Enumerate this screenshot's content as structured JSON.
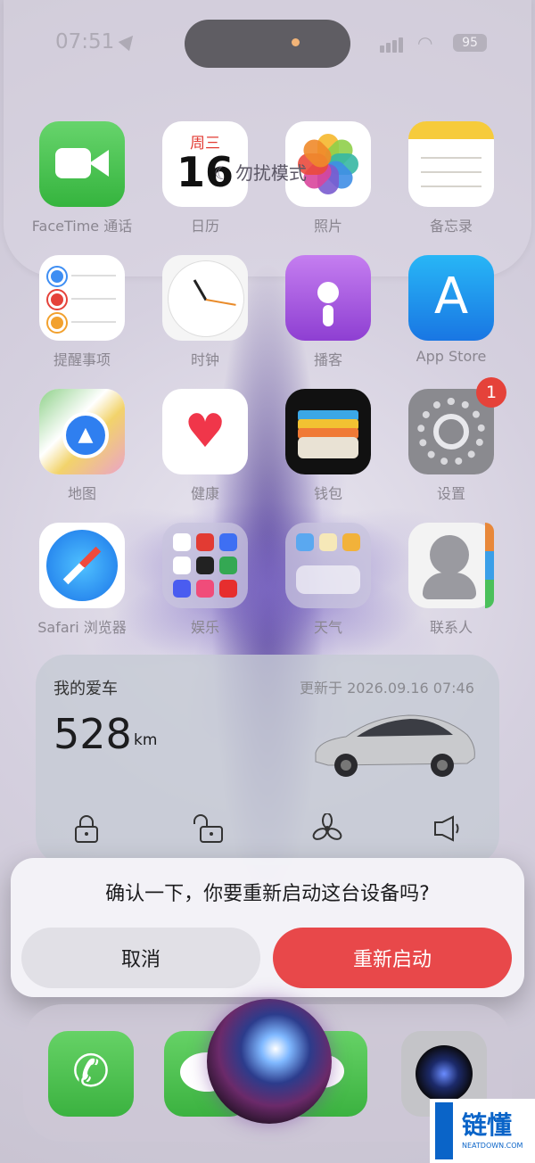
{
  "status_bar": {
    "time": "07:51",
    "battery": "95"
  },
  "dnd": {
    "label": "勿扰模式",
    "icon": "moon-icon"
  },
  "apps": [
    {
      "label": "FaceTime 通话",
      "icon": "facetime-icon"
    },
    {
      "label": "日历",
      "icon": "calendar-icon",
      "day": "周三",
      "date": "16"
    },
    {
      "label": "照片",
      "icon": "photos-icon"
    },
    {
      "label": "备忘录",
      "icon": "notes-icon"
    },
    {
      "label": "提醒事项",
      "icon": "reminders-icon"
    },
    {
      "label": "时钟",
      "icon": "clock-icon"
    },
    {
      "label": "播客",
      "icon": "podcasts-icon"
    },
    {
      "label": "App Store",
      "icon": "app-store-icon"
    },
    {
      "label": "地图",
      "icon": "maps-icon"
    },
    {
      "label": "健康",
      "icon": "health-icon"
    },
    {
      "label": "钱包",
      "icon": "wallet-icon"
    },
    {
      "label": "设置",
      "icon": "settings-icon",
      "badge": "1"
    },
    {
      "label": "Safari 浏览器",
      "icon": "safari-icon"
    },
    {
      "label": "娱乐",
      "icon": "folder-icon"
    },
    {
      "label": "天气",
      "icon": "folder-icon"
    },
    {
      "label": "联系人",
      "icon": "contacts-icon"
    }
  ],
  "widget": {
    "title": "我的爱车",
    "updated": "更新于 2026.09.16 07:46",
    "range": "528",
    "unit": "km"
  },
  "alert": {
    "message": "确认一下，你要重新启动这台设备吗?",
    "cancel": "取消",
    "confirm": "重新启动"
  },
  "dock": {
    "apps": [
      "phone-icon",
      "messages-icon",
      "camera-icon"
    ]
  },
  "watermark": {
    "text": "链懂",
    "sub": "NEATDOWN.COM"
  },
  "colors": {
    "accent_red": "#e8484a",
    "facetime_green": "#35b43e"
  }
}
